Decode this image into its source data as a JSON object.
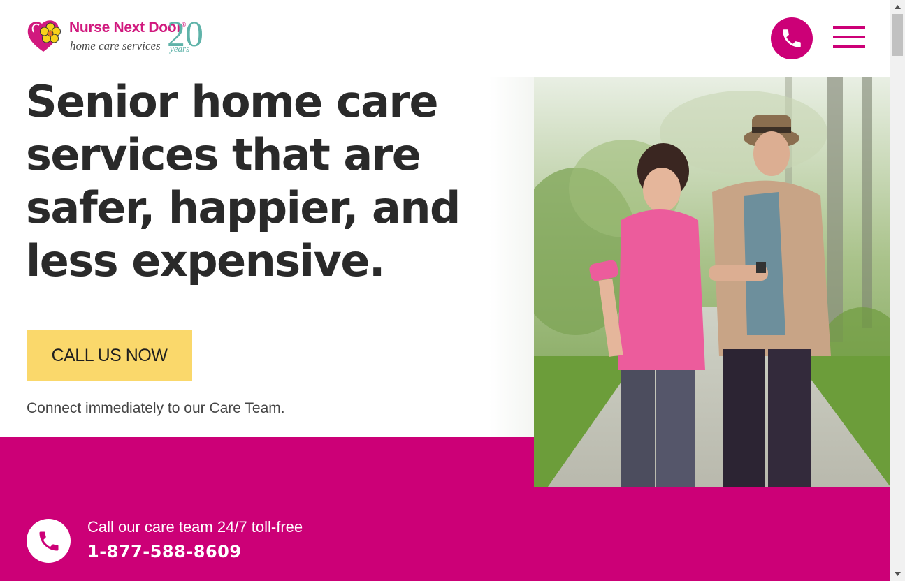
{
  "brand": {
    "name": "Nurse Next Door",
    "registered": "®",
    "tagline": "home care services",
    "anniversary_number": "20",
    "anniversary_word": "years",
    "primary_color": "#cc0077",
    "accent_color": "#fad86b",
    "teal_color": "#5fb3a9"
  },
  "header": {
    "phone_icon": "phone-icon",
    "menu_icon": "hamburger-menu-icon"
  },
  "hero": {
    "headline_lines": [
      "Senior home care",
      "services that are",
      "safer, happier, and",
      "less expensive."
    ],
    "cta_label": "CALL US NOW",
    "cta_subtext": "Connect immediately to our Care Team."
  },
  "contact_band": {
    "text": "Call our care team 24/7 toll-free",
    "phone_number": "1-877-588-8609",
    "icon": "phone-icon"
  },
  "scrollbar": {
    "up_icon": "scroll-up-arrow-icon",
    "down_icon": "scroll-down-arrow-icon"
  }
}
